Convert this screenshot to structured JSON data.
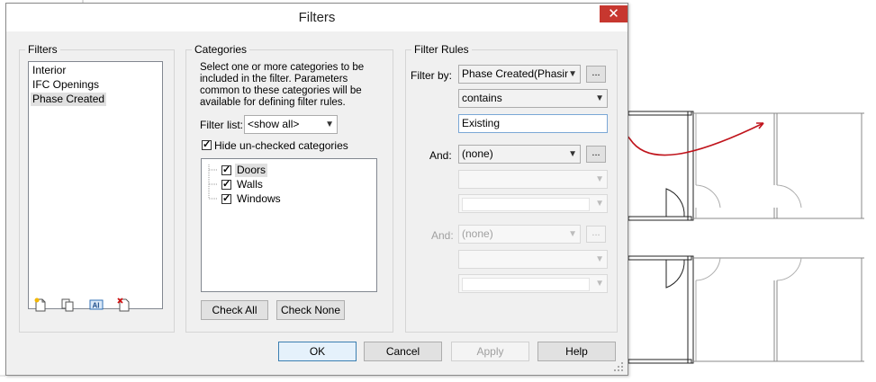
{
  "dialog": {
    "title": "Filters",
    "close_glyph": "✕"
  },
  "filters_panel": {
    "legend": "Filters",
    "items": [
      "Interior",
      "IFC Openings",
      "Phase Created"
    ],
    "selected": "Phase Created",
    "toolbar_icons": [
      "new-filter-icon",
      "duplicate-filter-icon",
      "rename-filter-icon",
      "delete-filter-icon"
    ]
  },
  "categories_panel": {
    "legend": "Categories",
    "description": "Select one or more categories to be included in the filter.  Parameters common to these categories will be available for defining filter rules.",
    "filter_list_label": "Filter list:",
    "filter_list_value": "<show all>",
    "hide_unchecked_label": "Hide un-checked categories",
    "hide_unchecked_checked": true,
    "categories": [
      {
        "label": "Doors",
        "checked": true
      },
      {
        "label": "Walls",
        "checked": true
      },
      {
        "label": "Windows",
        "checked": true
      }
    ],
    "check_all_label": "Check All",
    "check_none_label": "Check None"
  },
  "rules_panel": {
    "legend": "Filter Rules",
    "filter_by_label": "Filter by:",
    "filter_by_value": "Phase Created(Phasing",
    "operator_value": "contains",
    "value_text": "Existing",
    "and1_label": "And:",
    "and1_value": "(none)",
    "and2_label": "And:",
    "and2_value": "(none)",
    "ellipsis": "..."
  },
  "buttons": {
    "ok": "OK",
    "cancel": "Cancel",
    "apply": "Apply",
    "help": "Help"
  },
  "colors": {
    "arrow": "#c0141c",
    "close_button": "#c7372f",
    "plan_lines": "#222222"
  }
}
